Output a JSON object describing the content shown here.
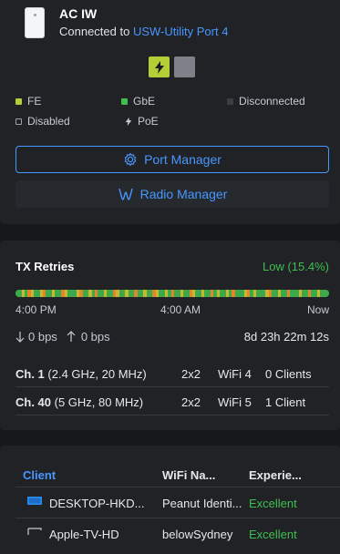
{
  "device": {
    "name": "AC IW",
    "connected_prefix": "Connected to ",
    "uplink": "USW-Utility Port 4",
    "thumb_icon": "access-point-icon",
    "ports": [
      {
        "state": "gbe-poe",
        "color": "#b3cf36"
      },
      {
        "state": "disabled",
        "color": "#7e8288"
      }
    ],
    "legend": [
      {
        "label": "FE",
        "color": "#b3cf36"
      },
      {
        "label": "GbE",
        "color": "#3fbf4f"
      },
      {
        "label": "Disconnected",
        "color": "#3a3d42"
      },
      {
        "label": "Disabled",
        "color": "outline"
      },
      {
        "label": "PoE",
        "icon": "lightning-icon"
      }
    ],
    "port_manager_label": "Port Manager",
    "radio_manager_label": "Radio Manager"
  },
  "tx_retries": {
    "title": "TX Retries",
    "status": "Low (15.4%)",
    "status_color": "#3fbf4f",
    "timeline_labels": [
      "4:00 PM",
      "4:00 AM",
      "Now"
    ],
    "pattern": "GGYGOYGGYOGGYGGOYGGGYOGGYGOGGYGGOYGGYGGOGGYGGOYGGYGOGGYGGOYGGYGGOGYGGYGOGGGYOGYGGGYOGGYGGOGGGYGGOGGYGGG",
    "download_rate": "0 bps",
    "upload_rate": "0 bps",
    "uptime": "8d 23h 22m 12s",
    "channels": [
      {
        "ch": "Ch. 1",
        "detail": " (2.4 GHz, 20 MHz)",
        "mimo": "2x2",
        "wifi": "WiFi 4",
        "clients": "0 Clients"
      },
      {
        "ch": "Ch. 40",
        "detail": " (5 GHz, 80 MHz)",
        "mimo": "2x2",
        "wifi": "WiFi 5",
        "clients": "1 Client"
      }
    ]
  },
  "clients": {
    "headers": [
      "Client",
      "WiFi Na...",
      "Experie..."
    ],
    "rows": [
      {
        "name": "DESKTOP-HKD...",
        "wifi": "Peanut Identi...",
        "experience": "Excellent",
        "icon": "desktop-icon"
      },
      {
        "name": "Apple-TV-HD",
        "wifi": "belowSydney",
        "experience": "Excellent",
        "icon": "tv-icon"
      }
    ]
  }
}
